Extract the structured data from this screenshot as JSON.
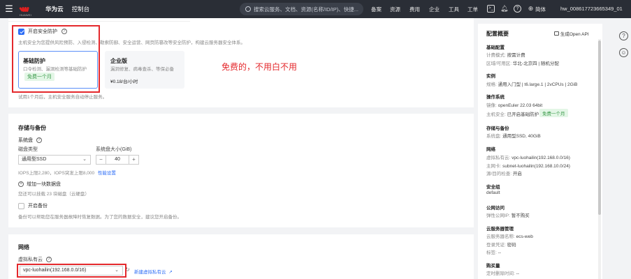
{
  "topbar": {
    "brand_sub": "HUAWEI",
    "brand": "华为云",
    "console": "控制台",
    "search_placeholder": "搜索云服务、文档、资源(名称/ID/IP)、快捷...",
    "nav": [
      "备案",
      "资源",
      "费用",
      "企业",
      "工具",
      "工单"
    ],
    "lang": "简体",
    "user": "hw_008617723665349_01"
  },
  "security": {
    "enable_label": "开启安全防护",
    "desc": "主机安全为您提供风险预防、入侵检测、勒索防御、安全运营、网页防篡改等安全防护，构建云服务器安全体系。",
    "basic": {
      "title": "基础防护",
      "desc": "口令检测、漏洞检测等基础防护",
      "tag": "免费一个月"
    },
    "enterprise": {
      "title": "企业版",
      "desc": "漏洞修复、病毒查杀、等保必备",
      "price": "¥0.18/台/小时"
    },
    "trial_note": "试用1个月后，主机安全服务自动停止服务。",
    "annotation": "免费的，不用白不用"
  },
  "storage": {
    "title": "存储与备份",
    "system_disk": "系统盘",
    "disk_type_label": "磁盘类型",
    "disk_size_label": "系统盘大小(GiB)",
    "disk_type_value": "通用型SSD",
    "disk_size_value": "40",
    "iops": "IOPS上限2,280，IOPS突发上限8,000",
    "iops_link": "性能设置",
    "add_disk": "增加一块数据盘",
    "add_disk_note": "您还可以挂载 23 块磁盘（云硬盘）",
    "backup_label": "开启备份",
    "backup_desc": "备份可以帮助您在服务器故障时恢复数据。为了您的数据安全，建议您开启备份。"
  },
  "network": {
    "title": "网络",
    "vpc_label": "虚拟私有云",
    "vpc_value": "vpc-luohailin(192.168.0.0/16)",
    "new_vpc_link": "新建虚拟私有云"
  },
  "summary": {
    "title": "配置概要",
    "openapi": "生成Open API",
    "sections": [
      {
        "label": "基础配置",
        "items": [
          [
            "计费模式: ",
            "按需计费"
          ],
          [
            "区域/可用区: ",
            "华北-北京四 | 随机分配"
          ]
        ]
      },
      {
        "label": "实例",
        "items": [
          [
            "规格: ",
            "通用入门型 | t6.large.1 | 2vCPUs | 2GiB"
          ]
        ]
      },
      {
        "label": "操作系统",
        "items": [
          [
            "镜像: ",
            "openEuler 22.03 64bit"
          ],
          [
            "主机安全: ",
            "已开启基础防护"
          ]
        ]
      },
      {
        "label": "存储与备份",
        "items": [
          [
            "系统盘: ",
            "通用型SSD, 40GiB"
          ]
        ]
      },
      {
        "label": "网络",
        "items": [
          [
            "虚拟私有云: ",
            "vpc-luohailin(192.168.0.0/16)"
          ],
          [
            "主网卡: ",
            "subnet-luohailin(192.168.10.0/24)"
          ],
          [
            "源/目的检查: ",
            "开启"
          ]
        ]
      },
      {
        "label": "安全组",
        "items": [
          [
            "",
            "default"
          ]
        ]
      },
      {
        "label": "公网访问",
        "items": [
          [
            "弹性公网IP: ",
            "暂不购买"
          ]
        ]
      },
      {
        "label": "云服务器管理",
        "items": [
          [
            "云服务器名称: ",
            "ecs-web"
          ],
          [
            "登录凭证: ",
            "密码"
          ],
          [
            "标签: ",
            "--"
          ]
        ]
      },
      {
        "label": "购买量",
        "items": [
          [
            "定时删除时间: ",
            "--"
          ]
        ]
      }
    ],
    "security_tag": "免费一个月"
  }
}
